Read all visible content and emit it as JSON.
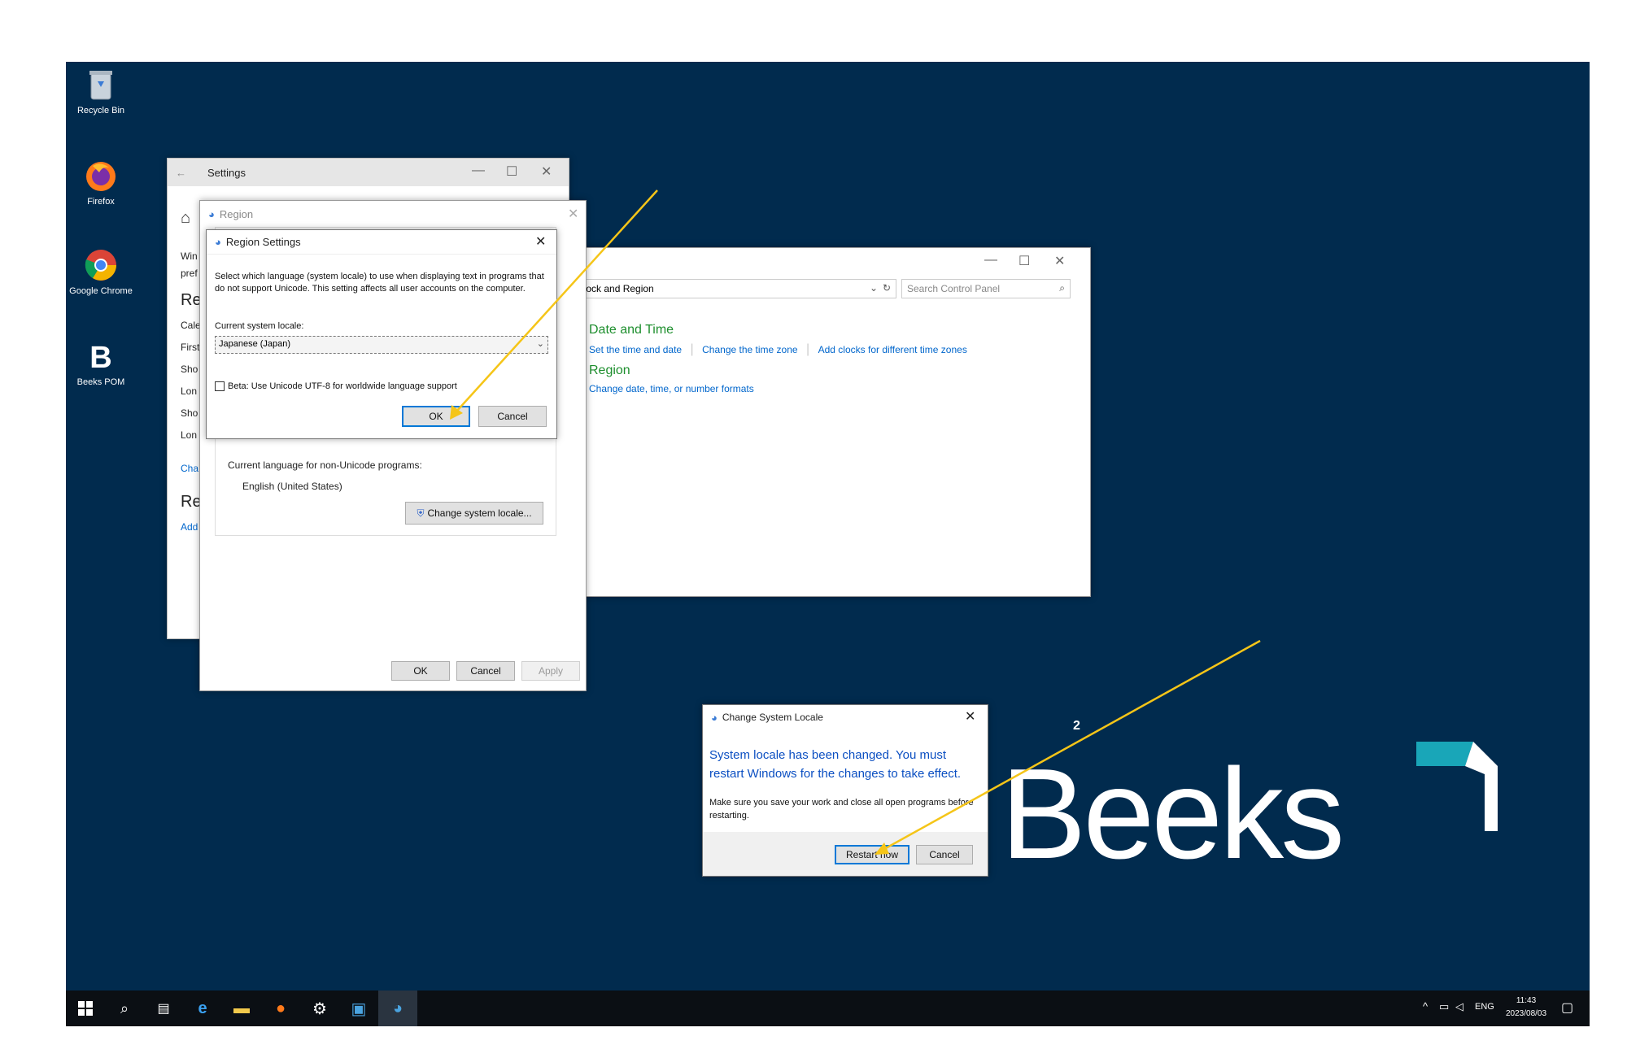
{
  "desktop_icons": [
    {
      "label": "Recycle Bin",
      "icon": "recycle-bin-icon"
    },
    {
      "label": "Firefox",
      "icon": "firefox-icon"
    },
    {
      "label": "Google Chrome",
      "icon": "chrome-icon"
    },
    {
      "label": "Beeks POM",
      "icon": "beeks-pom-icon"
    }
  ],
  "settings_window": {
    "title": "Settings",
    "side_texts": [
      "Win",
      "pref",
      "Reg",
      "Cale",
      "First",
      "Sho",
      "Lon",
      "Sho",
      "Lon",
      "Cha",
      "Rel",
      "Add"
    ]
  },
  "region_window": {
    "title": "Region",
    "current_lang_label": "Current language for non-Unicode programs:",
    "current_lang_value": "English (United States)",
    "change_locale_button": "Change system locale...",
    "ok": "OK",
    "cancel": "Cancel",
    "apply": "Apply"
  },
  "region_settings_dialog": {
    "title": "Region Settings",
    "description": "Select which language (system locale) to use when displaying text in programs that do not support Unicode. This setting affects all user accounts on the computer.",
    "locale_label": "Current system locale:",
    "locale_value": "Japanese (Japan)",
    "beta_checkbox": "Beta: Use Unicode UTF-8 for worldwide language support",
    "ok": "OK",
    "cancel": "Cancel"
  },
  "control_panel": {
    "address": "Clock and Region",
    "search_placeholder": "Search Control Panel",
    "date_time_heading": "Date and Time",
    "date_time_links": [
      "Set the time and date",
      "Change the time zone",
      "Add clocks for different time zones"
    ],
    "region_heading": "Region",
    "region_link": "Change date, time, or number formats"
  },
  "change_locale_dialog": {
    "title": "Change System Locale",
    "main_message": "System locale has been changed. You must restart Windows for the changes to take effect.",
    "sub_message": "Make sure you save your work and close all open programs before restarting.",
    "restart_button": "Restart now",
    "cancel_button": "Cancel"
  },
  "annotation": {
    "step_number": "2",
    "arrow_color": "#f5c518"
  },
  "logo": {
    "text": "Beeks",
    "accent_color": "#19a6b8"
  },
  "taskbar": {
    "icons": [
      "start-icon",
      "search-icon",
      "task-view-icon",
      "edge-icon",
      "file-explorer-icon",
      "firefox-icon",
      "settings-gear-icon",
      "server-manager-icon",
      "region-globe-icon"
    ],
    "language": "ENG",
    "time": "11:43",
    "date": "2023/08/03"
  },
  "colors": {
    "desktop_bg": "#012b4e",
    "taskbar_bg": "#0b0f14",
    "link_blue": "#0066cc",
    "cp_green": "#1e8f2e"
  }
}
